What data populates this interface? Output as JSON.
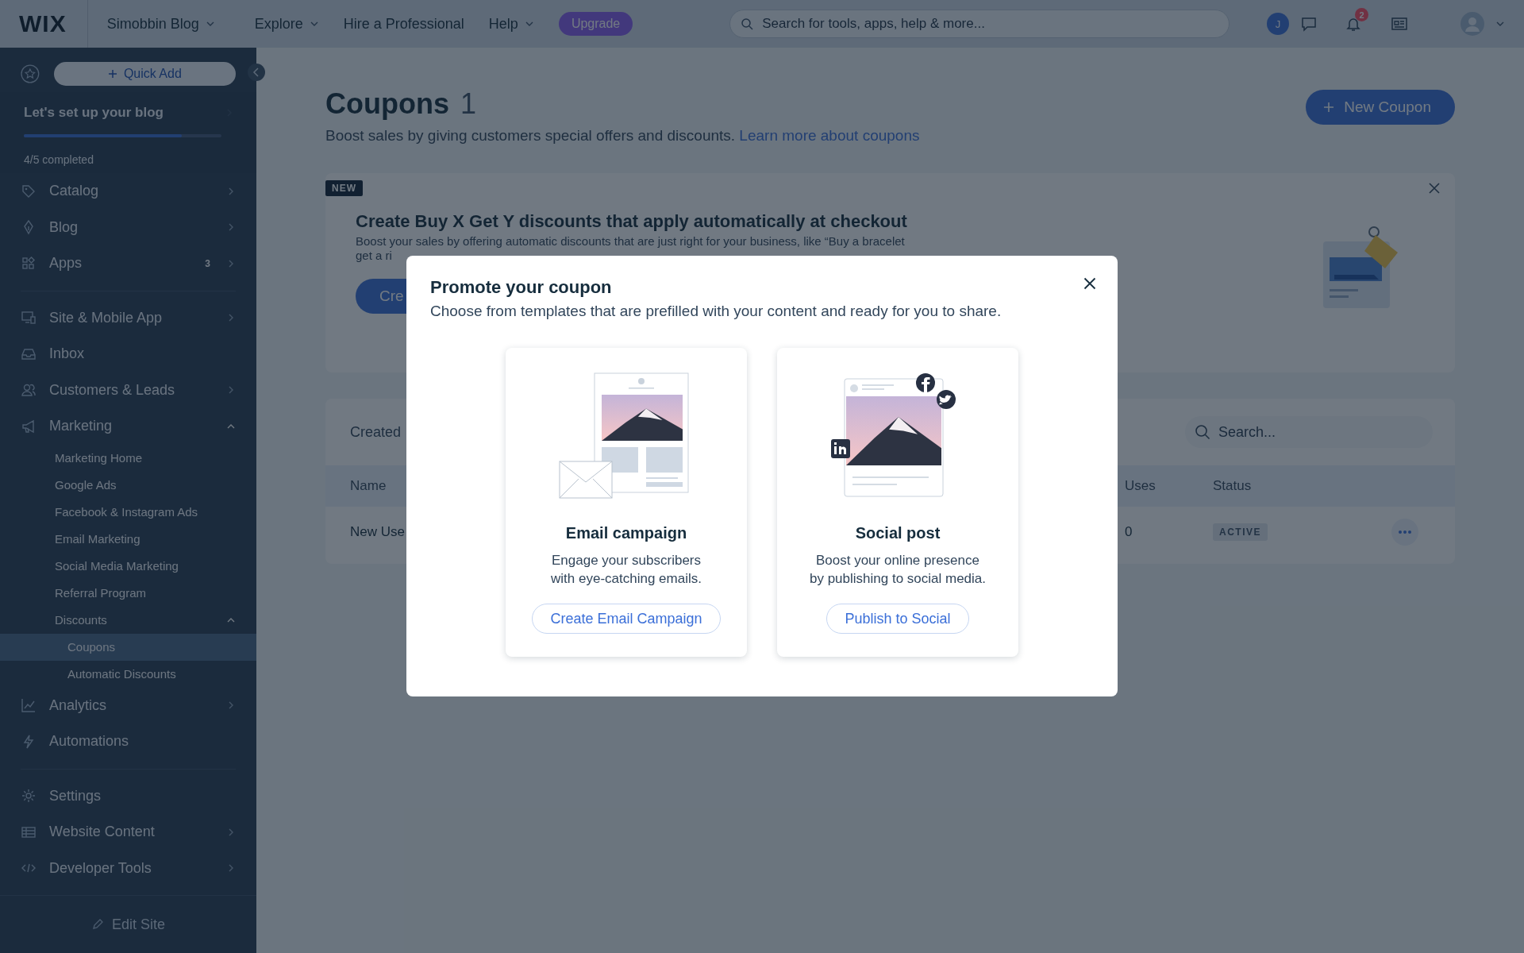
{
  "top_bar": {
    "logo": "WIX",
    "site": "Simobbin Blog",
    "nav": [
      {
        "label": "Explore",
        "dropdown": true
      },
      {
        "label": "Hire a Professional",
        "dropdown": false
      },
      {
        "label": "Help",
        "dropdown": true
      }
    ],
    "upgrade": "Upgrade",
    "search": {
      "placeholder": "Search for tools, apps, help & more..."
    },
    "account_initial": "J",
    "notifications": "2"
  },
  "sidebar": {
    "quick_add": "Quick Add",
    "setup": {
      "title": "Let's set up your blog",
      "level": 0.8,
      "progress": "4/5 completed"
    },
    "sections": [
      [
        {
          "label": "Catalog",
          "selected": false,
          "expanded": false
        },
        {
          "label": "Blog",
          "selected": false,
          "expanded": false
        },
        {
          "label": "Apps",
          "selected": false,
          "expanded": false,
          "badge": "3"
        }
      ],
      [
        {
          "label": "Site & Mobile App",
          "selected": false,
          "expanded": false
        },
        {
          "label": "Inbox",
          "selected": false
        },
        {
          "label": "Customers & Leads",
          "selected": false,
          "expanded": false
        },
        {
          "label": "Marketing",
          "selected": false,
          "expanded": true,
          "children": [
            {
              "label": "Marketing Home",
              "selected": false
            },
            {
              "label": "Google Ads",
              "selected": false
            },
            {
              "label": "Facebook & Instagram Ads",
              "selected": false
            },
            {
              "label": "Email Marketing",
              "selected": false
            },
            {
              "label": "Social Media Marketing",
              "selected": false
            },
            {
              "label": "Referral Program",
              "selected": false
            },
            {
              "label": "Discounts",
              "selected": false,
              "expanded": true,
              "children": [
                {
                  "label": "Coupons",
                  "selected": true
                },
                {
                  "label": "Automatic Discounts",
                  "selected": false
                }
              ]
            }
          ]
        },
        {
          "label": "Analytics",
          "selected": false,
          "expanded": false
        },
        {
          "label": "Automations",
          "selected": false
        }
      ],
      [
        {
          "label": "Settings",
          "selected": false
        },
        {
          "label": "Website Content",
          "selected": false,
          "expanded": false
        },
        {
          "label": "Developer Tools",
          "selected": false,
          "expanded": false
        }
      ]
    ],
    "edit_site": "Edit Site"
  },
  "page": {
    "title": "Coupons",
    "count": "1",
    "subtitle": "Boost sales by giving customers special offers and discounts.",
    "link": "Learn more about coupons",
    "new_button": "New Coupon"
  },
  "banner": {
    "tag": "NEW",
    "title": "Create Buy X Get Y discounts that apply automatically at checkout",
    "lines": [
      "Boost your sales by offering automatic discounts that are just right for your business, like “Buy a bracelet",
      "get a ri"
    ],
    "button": "Cre"
  },
  "table": {
    "filter_label": "Created",
    "search": {
      "placeholder": "Search..."
    },
    "columns": [
      "Name",
      "Uses",
      "Status"
    ],
    "rows": [
      {
        "name": "New Use",
        "uses": "0",
        "status": "ACTIVE"
      }
    ]
  },
  "modal": {
    "title": "Promote your coupon",
    "subtitle": "Choose from templates that are prefilled with your content and ready for you to share.",
    "options": [
      {
        "kind": "email",
        "title": "Email campaign",
        "description": "Engage your subscribers\nwith eye-catching emails.",
        "button": "Create Email Campaign"
      },
      {
        "kind": "social",
        "title": "Social post",
        "description": "Boost your online presence\nby publishing to social media.",
        "button": "Publish to Social"
      }
    ]
  }
}
